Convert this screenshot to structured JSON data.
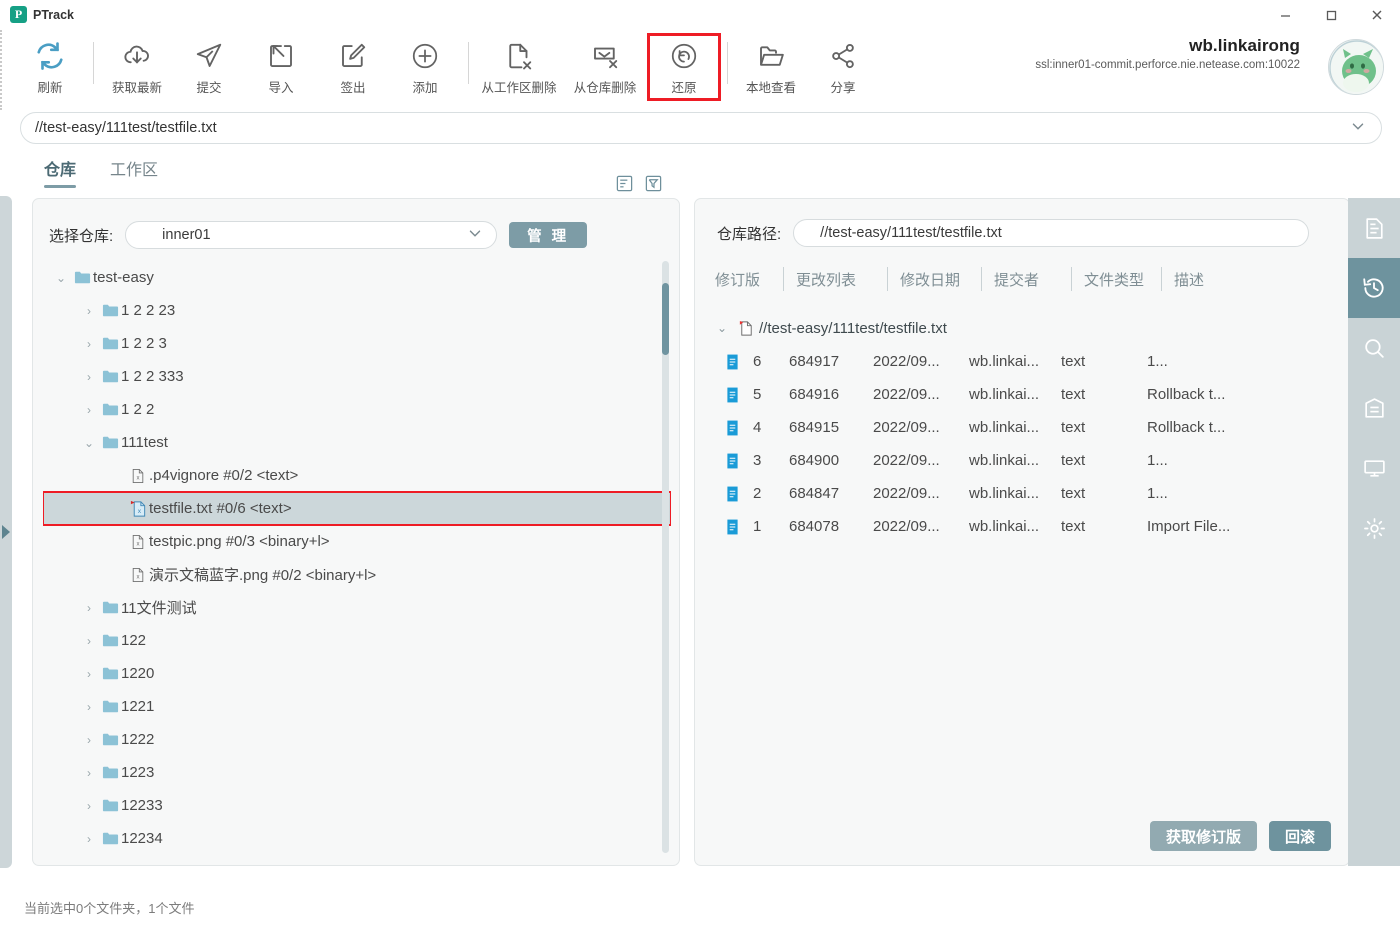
{
  "window": {
    "brand": "PTrack",
    "brand_mark": "P",
    "minimize": "−",
    "maximize": "□",
    "close": "✕"
  },
  "toolbar": {
    "buttons": [
      {
        "label": "刷新",
        "icon": "refresh-icon"
      },
      {
        "label": "获取最新",
        "icon": "cloud-download-icon"
      },
      {
        "label": "提交",
        "icon": "send-paperplane-icon"
      },
      {
        "label": "导入",
        "icon": "import-arrow-icon"
      },
      {
        "label": "签出",
        "icon": "checkout-pencil-icon"
      },
      {
        "label": "添加",
        "icon": "plus-circle-icon"
      },
      {
        "label": "从工作区删除",
        "icon": "file-delete-icon"
      },
      {
        "label": "从仓库删除",
        "icon": "repo-delete-icon"
      },
      {
        "label": "还原",
        "icon": "revert-undo-icon",
        "highlighted": true
      },
      {
        "label": "本地查看",
        "icon": "folder-open-icon"
      },
      {
        "label": "分享",
        "icon": "share-nodes-icon"
      }
    ],
    "highlight_color": "#ee1c25"
  },
  "account": {
    "username": "wb.linkairong",
    "server": "ssl:inner01-commit.perforce.nie.netease.com:10022",
    "avatar": "green-creature-avatar"
  },
  "path_bar": {
    "value": "//test-easy/111test/testfile.txt",
    "chevron": "chevron-down-icon"
  },
  "tabs": {
    "items": [
      {
        "label": "仓库",
        "active": true
      },
      {
        "label": "工作区",
        "active": false
      }
    ],
    "tools": [
      {
        "icon": "sort-list-icon"
      },
      {
        "icon": "filter-funnel-icon"
      }
    ],
    "accent": "#7d9ca6"
  },
  "left_panel": {
    "repo_label": "选择仓库:",
    "repo_value": "inner01",
    "manage_button": "管 理",
    "tree": [
      {
        "name": "test-easy",
        "type": "folder",
        "depth": 0,
        "state": "expanded"
      },
      {
        "name": "1 2 2 23",
        "type": "folder",
        "depth": 1,
        "state": "collapsed"
      },
      {
        "name": "1 2 2 3",
        "type": "folder",
        "depth": 1,
        "state": "collapsed"
      },
      {
        "name": "1 2 2 333",
        "type": "folder",
        "depth": 1,
        "state": "collapsed"
      },
      {
        "name": "1 2 2",
        "type": "folder",
        "depth": 1,
        "state": "collapsed"
      },
      {
        "name": "111test",
        "type": "folder",
        "depth": 1,
        "state": "expanded"
      },
      {
        "name": ".p4vignore  #0/2 <text>",
        "type": "file",
        "depth": 2,
        "state": "none"
      },
      {
        "name": "testfile.txt  #0/6 <text>",
        "type": "file-checked-out",
        "depth": 2,
        "state": "none",
        "selected": true,
        "highlighted": true
      },
      {
        "name": "testpic.png  #0/3 <binary+l>",
        "type": "file",
        "depth": 2,
        "state": "none"
      },
      {
        "name": "演示文稿蓝字.png  #0/2 <binary+l>",
        "type": "file",
        "depth": 2,
        "state": "none"
      },
      {
        "name": "11文件测试",
        "type": "folder",
        "depth": 1,
        "state": "collapsed"
      },
      {
        "name": "122",
        "type": "folder",
        "depth": 1,
        "state": "collapsed"
      },
      {
        "name": "1220",
        "type": "folder",
        "depth": 1,
        "state": "collapsed"
      },
      {
        "name": "1221",
        "type": "folder",
        "depth": 1,
        "state": "collapsed"
      },
      {
        "name": "1222",
        "type": "folder",
        "depth": 1,
        "state": "collapsed"
      },
      {
        "name": "1223",
        "type": "folder",
        "depth": 1,
        "state": "collapsed"
      },
      {
        "name": "12233",
        "type": "folder",
        "depth": 1,
        "state": "collapsed"
      },
      {
        "name": "12234",
        "type": "folder",
        "depth": 1,
        "state": "collapsed"
      }
    ]
  },
  "right_panel": {
    "path_label": "仓库路径:",
    "path_value": "//test-easy/111test/testfile.txt",
    "columns": [
      "修订版",
      "更改列表",
      "修改日期",
      "提交者",
      "文件类型",
      "描述"
    ],
    "file_header": "//test-easy/111test/testfile.txt",
    "revisions": [
      {
        "rev": "6",
        "changelist": "684917",
        "date": "2022/09...",
        "user": "wb.linkai...",
        "type": "text",
        "desc": "1..."
      },
      {
        "rev": "5",
        "changelist": "684916",
        "date": "2022/09...",
        "user": "wb.linkai...",
        "type": "text",
        "desc": "Rollback t..."
      },
      {
        "rev": "4",
        "changelist": "684915",
        "date": "2022/09...",
        "user": "wb.linkai...",
        "type": "text",
        "desc": "Rollback t..."
      },
      {
        "rev": "3",
        "changelist": "684900",
        "date": "2022/09...",
        "user": "wb.linkai...",
        "type": "text",
        "desc": "1..."
      },
      {
        "rev": "2",
        "changelist": "684847",
        "date": "2022/09...",
        "user": "wb.linkai...",
        "type": "text",
        "desc": "1..."
      },
      {
        "rev": "1",
        "changelist": "684078",
        "date": "2022/09...",
        "user": "wb.linkai...",
        "type": "text",
        "desc": "Import File..."
      }
    ],
    "get_revision_button": "获取修订版",
    "rollback_button": "回滚"
  },
  "rail": {
    "items": [
      {
        "icon": "document-icon",
        "active": false
      },
      {
        "icon": "history-icon",
        "active": true
      },
      {
        "icon": "search-icon",
        "active": false
      },
      {
        "icon": "archive-icon",
        "active": false
      },
      {
        "icon": "monitor-icon",
        "active": false
      },
      {
        "icon": "gear-icon",
        "active": false
      }
    ],
    "active_color": "#6e939e",
    "bg_color": "#c9d3d6"
  },
  "status_bar": {
    "text": "当前选中0个文件夹，1个文件"
  }
}
